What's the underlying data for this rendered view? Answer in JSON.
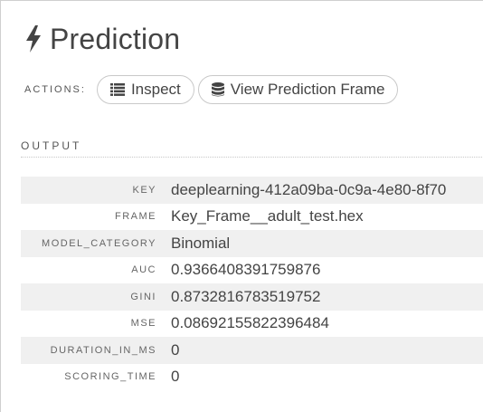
{
  "header": {
    "icon": "bolt-icon",
    "title": "Prediction"
  },
  "actions": {
    "label": "ACTIONS:",
    "buttons": [
      {
        "label": "Inspect",
        "icon": "list-icon"
      },
      {
        "label": "View Prediction Frame",
        "icon": "database-icon"
      }
    ]
  },
  "output": {
    "label": "OUTPUT",
    "rows": [
      {
        "key": "KEY",
        "value": "deeplearning-412a09ba-0c9a-4e80-8f70"
      },
      {
        "key": "FRAME",
        "value": "Key_Frame__adult_test.hex"
      },
      {
        "key": "MODEL_CATEGORY",
        "value": "Binomial"
      },
      {
        "key": "AUC",
        "value": "0.9366408391759876"
      },
      {
        "key": "GINI",
        "value": "0.8732816783519752"
      },
      {
        "key": "MSE",
        "value": "0.08692155822396484"
      },
      {
        "key": "DURATION_IN_MS",
        "value": "0"
      },
      {
        "key": "SCORING_TIME",
        "value": "0"
      }
    ]
  },
  "colors": {
    "text": "#444444",
    "row_shade": "#f0f0f0",
    "border": "#c9c9c9"
  }
}
